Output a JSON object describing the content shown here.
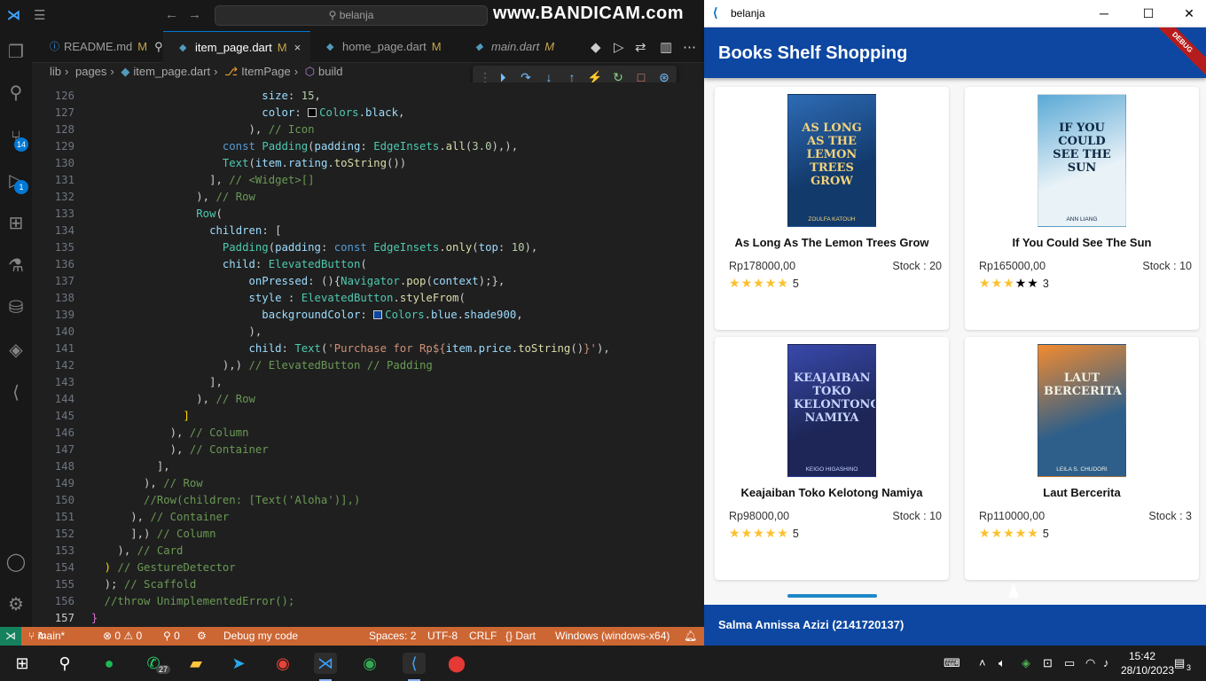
{
  "vscode": {
    "search_placeholder": "belanja",
    "watermark": "www.BANDICAM.com",
    "scm_badge": "14",
    "debug_badge": "1",
    "tabs": [
      {
        "label": "README.md",
        "mod": "M",
        "extra": "⚲"
      },
      {
        "label": "item_page.dart",
        "mod": "M",
        "extra": "×"
      },
      {
        "label": "home_page.dart",
        "mod": "M",
        "extra": ""
      },
      {
        "label": "main.dart",
        "mod": "M",
        "extra": ""
      }
    ],
    "breadcrumb": [
      "lib",
      "pages",
      "item_page.dart",
      "ItemPage",
      "build"
    ],
    "line_numbers": [
      "126",
      "127",
      "128",
      "129",
      "130",
      "131",
      "132",
      "133",
      "134",
      "135",
      "136",
      "137",
      "138",
      "139",
      "140",
      "141",
      "142",
      "143",
      "144",
      "145",
      "146",
      "147",
      "148",
      "149",
      "150",
      "151",
      "152",
      "153",
      "154",
      "155",
      "156",
      "157"
    ],
    "status": {
      "branch": "main*",
      "problems": "⊗ 0 ⚠ 0",
      "ports": "⚲ 0",
      "debug": "Debug my code",
      "spaces": "Spaces: 2",
      "encoding": "UTF-8",
      "eol": "CRLF",
      "language": "{} Dart",
      "device": "Windows (windows-x64)"
    }
  },
  "app": {
    "window_title": "belanja",
    "appbar_title": "Books Shelf Shopping",
    "debug_banner": "DEBUG",
    "footer": "Salma Annissa Azizi (2141720137)",
    "products": [
      {
        "title": "As Long As The Lemon Trees Grow",
        "price": "Rp178000,00",
        "stock": "Stock : 20",
        "rating": 5,
        "rating_label": "5",
        "cover_text": "AS LONG AS THE LEMON TREES GROW",
        "cover_author": "ZOULFA KATOUH"
      },
      {
        "title": "If You Could See The Sun",
        "price": "Rp165000,00",
        "stock": "Stock : 10",
        "rating": 3,
        "rating_label": "3",
        "cover_text": "IF YOU COULD SEE THE SUN",
        "cover_author": "ANN LIANG"
      },
      {
        "title": "Keajaiban Toko Kelotong Namiya",
        "price": "Rp98000,00",
        "stock": "Stock : 10",
        "rating": 5,
        "rating_label": "5",
        "cover_text": "KEAJAIBAN TOKO KELONTONG NAMIYA",
        "cover_author": "KEIGO HIGASHINO"
      },
      {
        "title": "Laut Bercerita",
        "price": "Rp110000,00",
        "stock": "Stock : 3",
        "rating": 5,
        "rating_label": "5",
        "cover_text": "LAUT BERCERITA",
        "cover_author": "LEILA S. CHUDORI"
      }
    ]
  },
  "taskbar": {
    "time": "15:42",
    "date": "28/10/2023",
    "whatsapp_badge": "27",
    "notifications": "3",
    "apps": [
      "start",
      "search",
      "spotify",
      "whatsapp",
      "file-explorer",
      "telegram",
      "chrome",
      "vscode",
      "chrome-profile",
      "flutter",
      "bandicam"
    ]
  },
  "colors": {
    "accent": "#0d47a1",
    "status_bar": "#cc6633",
    "star": "#fbc02d"
  }
}
